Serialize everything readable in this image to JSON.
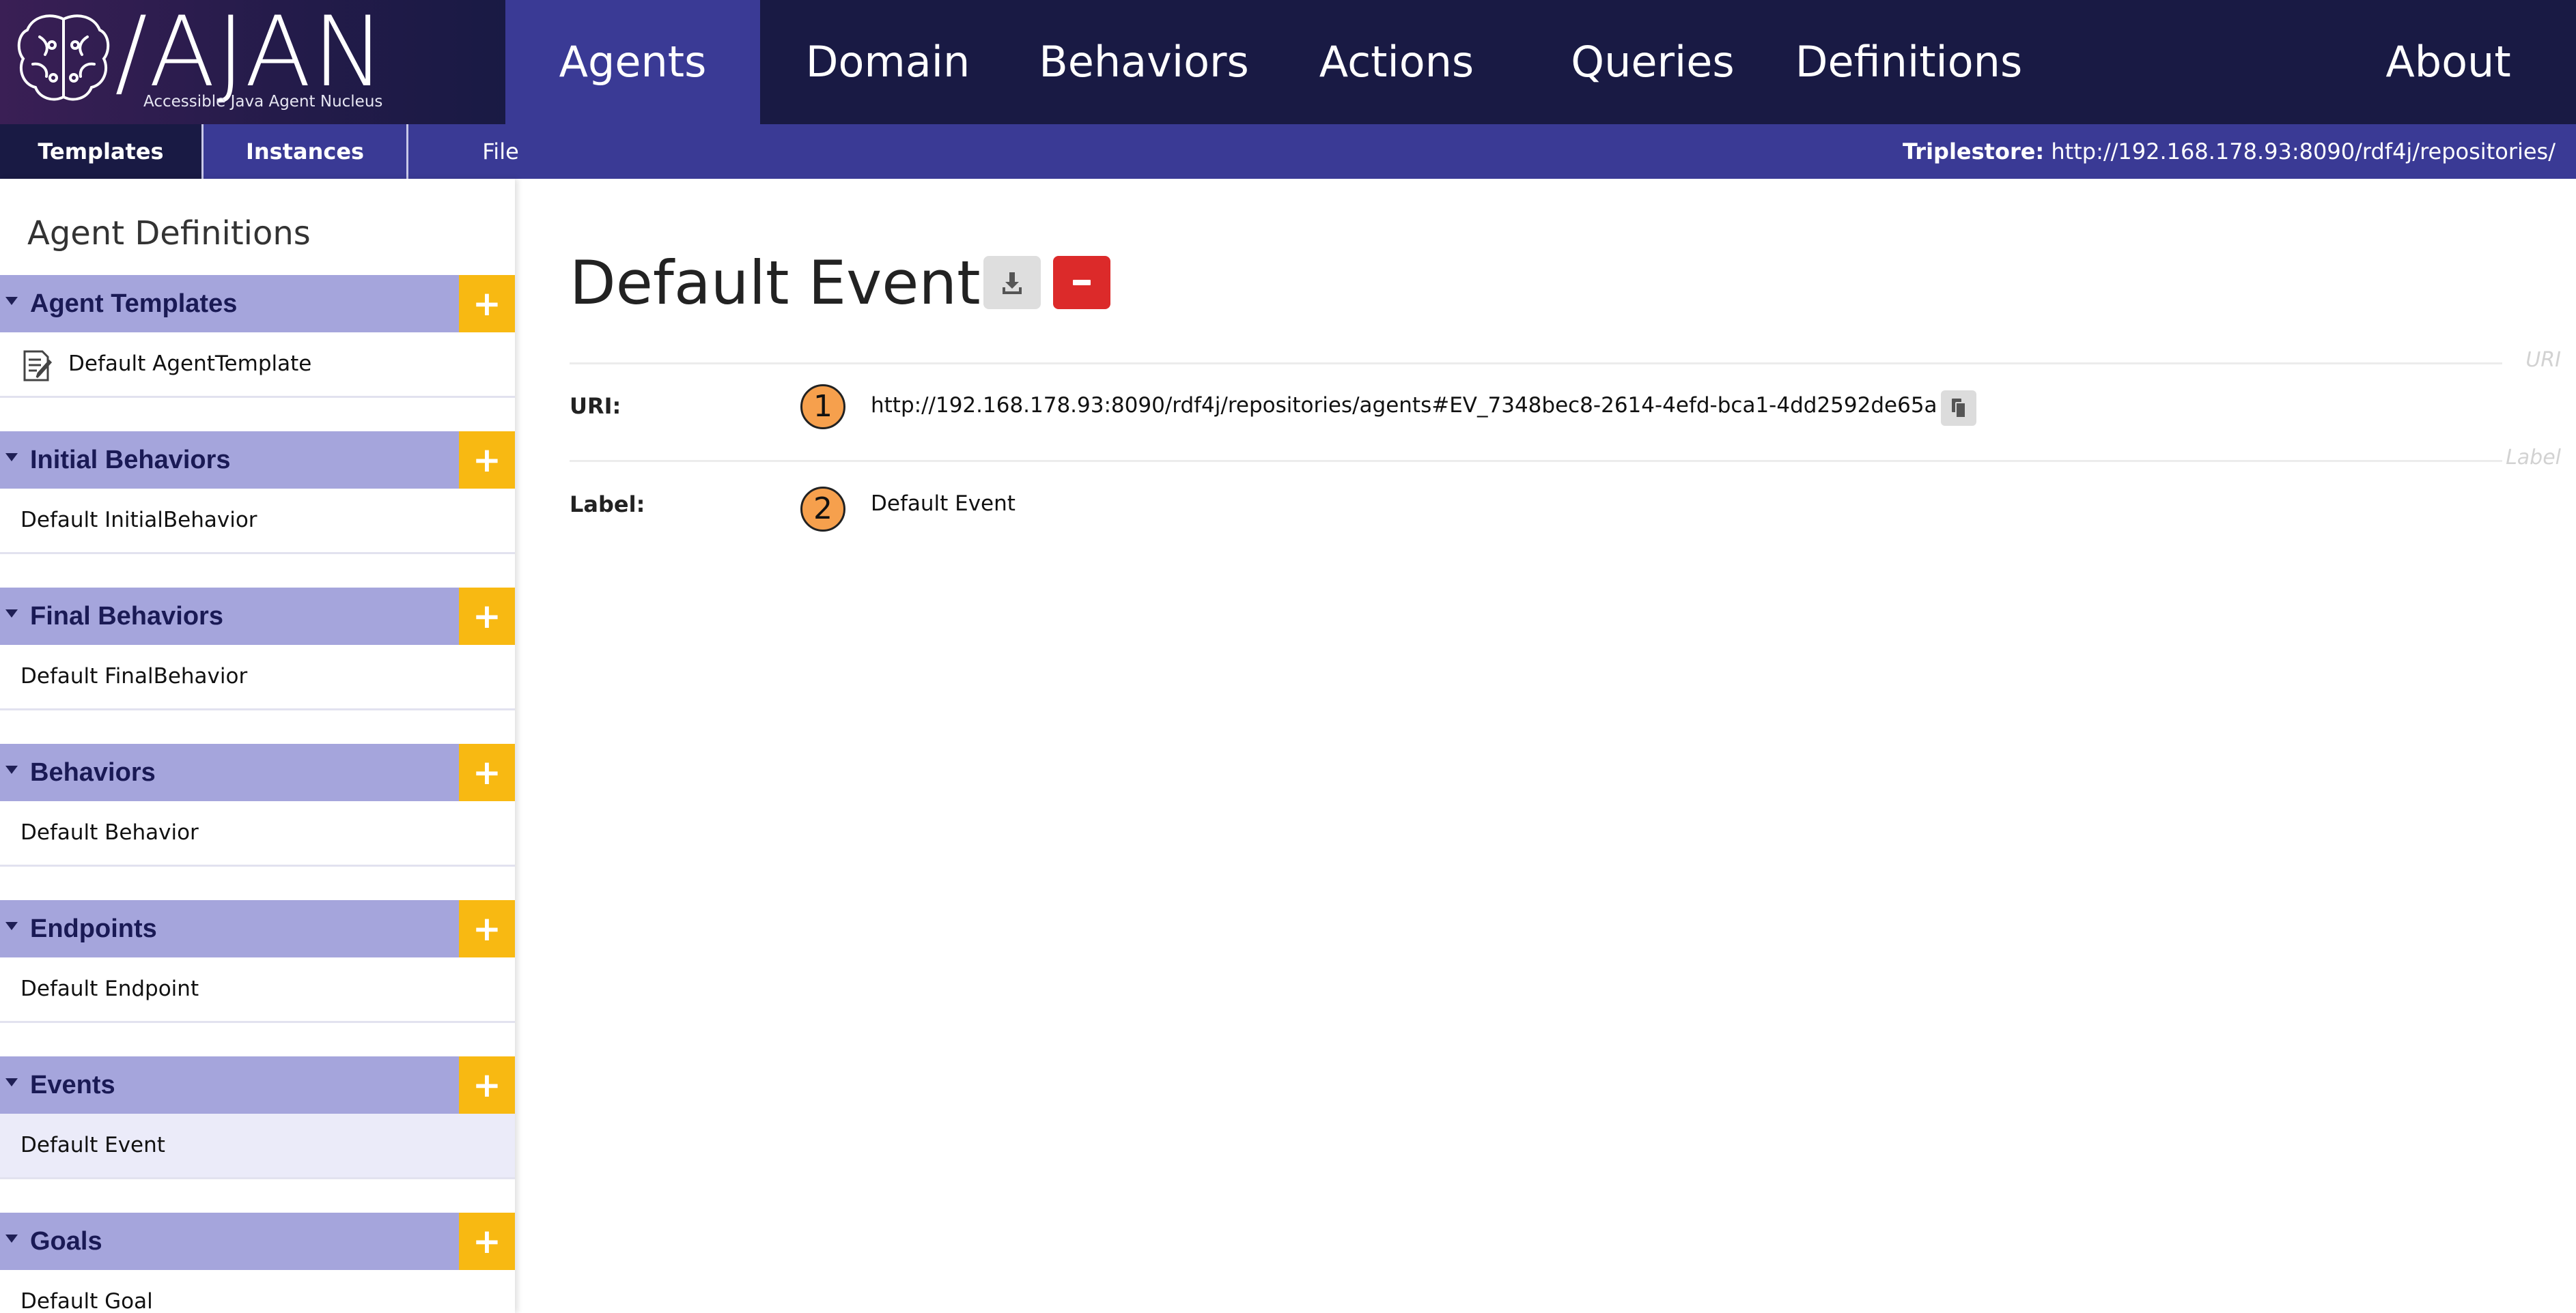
{
  "app": {
    "title": "/AJAN",
    "subtitle": "Accessible Java Agent Nucleus"
  },
  "nav": {
    "items": [
      {
        "label": "Agents",
        "active": true
      },
      {
        "label": "Domain",
        "active": false
      },
      {
        "label": "Behaviors",
        "active": false
      },
      {
        "label": "Actions",
        "active": false
      },
      {
        "label": "Queries",
        "active": false
      },
      {
        "label": "Definitions",
        "active": false
      },
      {
        "label": "About",
        "active": false
      }
    ]
  },
  "subnav": {
    "tabs": [
      {
        "label": "Templates",
        "active": true
      },
      {
        "label": "Instances",
        "active": false
      },
      {
        "label": "File",
        "active": false
      }
    ],
    "triplestore_label": "Triplestore:",
    "triplestore_url": "http://192.168.178.93:8090/rdf4j/repositories/"
  },
  "sidebar": {
    "title": "Agent Definitions",
    "sections": [
      {
        "label": "Agent Templates",
        "items": [
          {
            "label": "Default AgentTemplate",
            "icon": "template-doc-icon"
          }
        ]
      },
      {
        "label": "Initial Behaviors",
        "items": [
          {
            "label": "Default InitialBehavior"
          }
        ]
      },
      {
        "label": "Final Behaviors",
        "items": [
          {
            "label": "Default FinalBehavior"
          }
        ]
      },
      {
        "label": "Behaviors",
        "items": [
          {
            "label": "Default Behavior"
          }
        ]
      },
      {
        "label": "Endpoints",
        "items": [
          {
            "label": "Default Endpoint"
          }
        ]
      },
      {
        "label": "Events",
        "items": [
          {
            "label": "Default Event",
            "selected": true
          }
        ]
      },
      {
        "label": "Goals",
        "items": [
          {
            "label": "Default Goal"
          }
        ]
      }
    ],
    "add_symbol": "+"
  },
  "main": {
    "title": "Default Event",
    "uri_divider_label": "URI",
    "label_divider_label": "Label",
    "fields": [
      {
        "badge": "1",
        "label": "URI:",
        "value": "http://192.168.178.93:8090/rdf4j/repositories/agents#EV_7348bec8-2614-4efd-bca1-4dd2592de65a"
      },
      {
        "badge": "2",
        "label": "Label:",
        "value": "Default Event"
      }
    ]
  },
  "colors": {
    "topbar": "#191a44",
    "nav_active": "#3a3a95",
    "section_header": "#a5a5dc",
    "add_button": "#f8b912",
    "delete_button": "#dc2a2a",
    "badge": "#f6a04d"
  }
}
